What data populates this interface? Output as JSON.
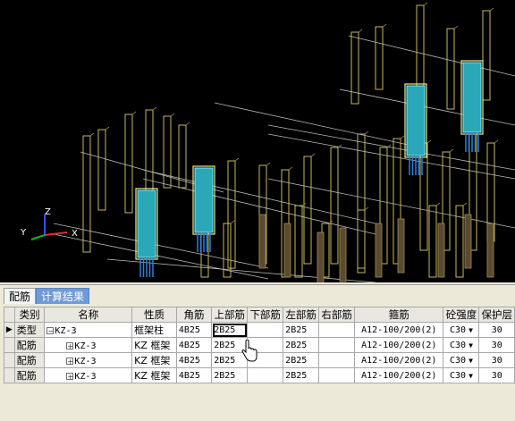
{
  "viewport": {
    "axis": {
      "z": "Z",
      "y": "Y",
      "x": "X"
    }
  },
  "panel": {
    "tabs": [
      {
        "label": "配筋",
        "active": true
      },
      {
        "label": "计算结果",
        "active": false
      }
    ],
    "columns": [
      "",
      "类别",
      "名称",
      "性质",
      "角筋",
      "上部筋",
      "下部筋",
      "左部筋",
      "右部筋",
      "箍筋",
      "砼强度",
      "保护层"
    ],
    "rows": [
      {
        "category": "类型",
        "tree": "minus",
        "name": "KZ-3",
        "property": "框架柱",
        "corner": "4B25",
        "top": "2B25",
        "bottom": "",
        "left": "2B25",
        "right": "",
        "stirrup": "A12-100/200(2)",
        "concrete": "C30",
        "cover": "30",
        "current": true
      },
      {
        "category": "配筋",
        "tree": "plus",
        "name": "KZ-3",
        "property": "KZ  框架",
        "corner": "4B25",
        "top": "2B25",
        "bottom": "",
        "left": "2B25",
        "right": "",
        "stirrup": "A12-100/200(2)",
        "concrete": "C30",
        "cover": "30",
        "current": false
      },
      {
        "category": "配筋",
        "tree": "plus",
        "name": "KZ-3",
        "property": "KZ  框架",
        "corner": "4B25",
        "top": "2B25",
        "bottom": "",
        "left": "2B25",
        "right": "",
        "stirrup": "A12-100/200(2)",
        "concrete": "C30",
        "cover": "30",
        "current": false
      },
      {
        "category": "配筋",
        "tree": "plus",
        "name": "KZ-3",
        "property": "KZ  框架",
        "corner": "4B25",
        "top": "2B25",
        "bottom": "",
        "left": "2B25",
        "right": "",
        "stirrup": "A12-100/200(2)",
        "concrete": "C30",
        "cover": "30",
        "current": false
      }
    ]
  }
}
